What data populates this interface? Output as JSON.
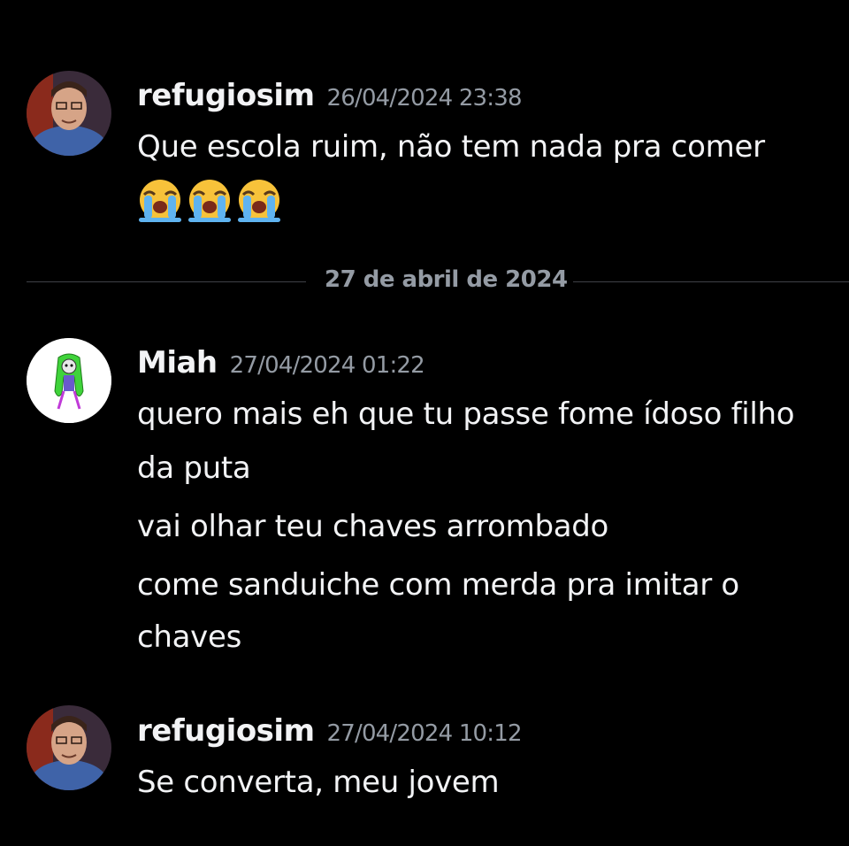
{
  "messages": [
    {
      "username": "refugiosim",
      "timestamp": "26/04/2024 23:38",
      "lines": [
        "Que escola ruim, não tem nada pra comer"
      ],
      "emojis": [
        "loudly-crying-face-icon",
        "loudly-crying-face-icon",
        "loudly-crying-face-icon"
      ]
    },
    {
      "username": "Miah",
      "timestamp": "27/04/2024 01:22",
      "lines": [
        "quero mais eh que tu passe fome ídoso filho",
        "da puta",
        "vai olhar teu chaves arrombado",
        "come sanduiche com merda pra imitar o",
        "chaves"
      ]
    },
    {
      "username": "refugiosim",
      "timestamp": "27/04/2024 10:12",
      "lines": [
        "Se converta, meu jovem"
      ]
    }
  ],
  "date_divider": "27 de abril de 2024",
  "colors": {
    "background": "#000000",
    "username": "#f2f3f5",
    "timestamp": "#949ba4",
    "divider": "#3f4147"
  }
}
